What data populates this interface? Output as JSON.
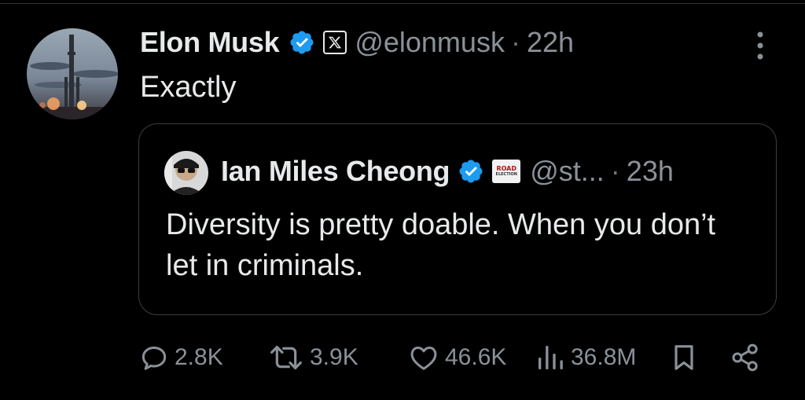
{
  "tweet": {
    "author_name": "Elon Musk",
    "handle": "@elonmusk",
    "separator": "·",
    "time": "22h",
    "text": "Exactly",
    "affiliation_badge": "x-logo-icon",
    "verified_color": "#1d9bf0"
  },
  "quoted_tweet": {
    "author_name": "Ian Miles Cheong",
    "handle": "@st...",
    "separator": "·",
    "time": "23h",
    "text": "Diversity is pretty doable. When you don’t let in criminals.",
    "affiliation_badge_text_1": "ROAD",
    "affiliation_badge_text_2": "ELECTION",
    "verified_color": "#1d9bf0"
  },
  "actions": {
    "replies": "2.8K",
    "reposts": "3.9K",
    "likes": "46.6K",
    "views": "36.8M",
    "icons": [
      "reply-icon",
      "repost-icon",
      "like-icon",
      "views-icon",
      "bookmark-icon",
      "share-icon"
    ]
  },
  "colors": {
    "background": "#000000",
    "text": "#e7e9ea",
    "muted": "#8b9198",
    "border": "#3a3f44",
    "verified": "#1d9bf0"
  }
}
